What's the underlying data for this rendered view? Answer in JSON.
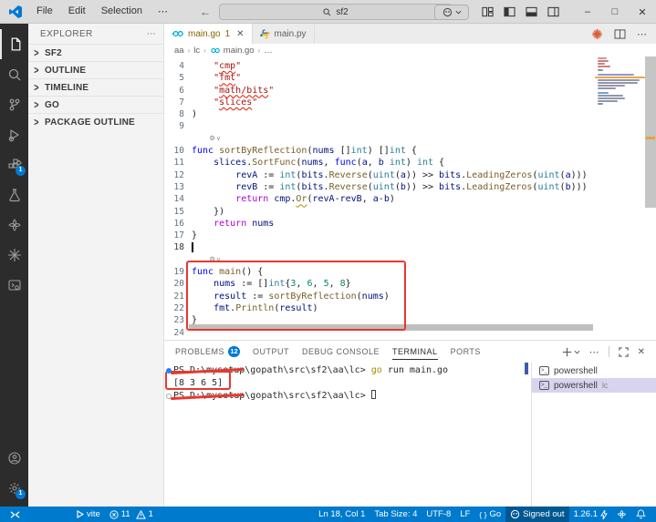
{
  "colors": {
    "accent": "#007acc",
    "badge": "#0078d4",
    "annotation": "#e8382c",
    "activity_bar_bg": "#2c2c2c",
    "warning_file": "#8a6400"
  },
  "titlebar": {
    "menus": [
      {
        "label": "File"
      },
      {
        "label": "Edit"
      },
      {
        "label": "Selection"
      }
    ],
    "search": {
      "value": "sf2"
    }
  },
  "activity_bar": {
    "items": [
      "explorer",
      "search",
      "source-control",
      "run-and-debug",
      "extensions",
      "testing",
      "pinwheel",
      "starburst",
      "remote-tools"
    ],
    "extensions_badge": "1",
    "settings_badge": "1"
  },
  "sidebar": {
    "header": "EXPLORER",
    "sections": [
      {
        "label": "SF2"
      },
      {
        "label": "OUTLINE"
      },
      {
        "label": "TIMELINE"
      },
      {
        "label": "GO"
      },
      {
        "label": "PACKAGE OUTLINE"
      }
    ]
  },
  "editor": {
    "tabs": [
      {
        "label": "main.go",
        "badge": "1",
        "active": true
      },
      {
        "label": "main.py",
        "active": false
      }
    ],
    "breadcrumb": [
      "aa",
      "lc",
      "main.go",
      "…"
    ],
    "code": {
      "lines": [
        {
          "num": "4",
          "tokens": [
            [
              "s",
              "    \""
            ],
            [
              "su",
              "cmp"
            ],
            [
              "s",
              "\""
            ]
          ]
        },
        {
          "num": "5",
          "tokens": [
            [
              "s",
              "    \""
            ],
            [
              "su",
              "fmt"
            ],
            [
              "s",
              "\""
            ]
          ]
        },
        {
          "num": "6",
          "tokens": [
            [
              "s",
              "    \""
            ],
            [
              "su",
              "math/bits"
            ],
            [
              "s",
              "\""
            ]
          ]
        },
        {
          "num": "7",
          "tokens": [
            [
              "s",
              "    \""
            ],
            [
              "su",
              "slices"
            ],
            [
              "s",
              "\""
            ]
          ]
        },
        {
          "num": "8",
          "tokens": [
            [
              "p",
              ")"
            ]
          ]
        },
        {
          "num": "9",
          "tokens": []
        },
        {
          "lens": true
        },
        {
          "num": "10",
          "tokens": [
            [
              "k",
              "func"
            ],
            [
              "p",
              " "
            ],
            [
              "f",
              "sortByReflection"
            ],
            [
              "p",
              "("
            ],
            [
              "v",
              "nums"
            ],
            [
              "p",
              " []"
            ],
            [
              "t",
              "int"
            ],
            [
              "p",
              ") []"
            ],
            [
              "t",
              "int"
            ],
            [
              "p",
              " {"
            ]
          ]
        },
        {
          "num": "11",
          "tokens": [
            [
              "p",
              "    "
            ],
            [
              "v",
              "slices"
            ],
            [
              "p",
              "."
            ],
            [
              "f",
              "SortFunc"
            ],
            [
              "p",
              "("
            ],
            [
              "v",
              "nums"
            ],
            [
              "p",
              ", "
            ],
            [
              "k",
              "func"
            ],
            [
              "p",
              "("
            ],
            [
              "v",
              "a"
            ],
            [
              "p",
              ", "
            ],
            [
              "v",
              "b"
            ],
            [
              "p",
              " "
            ],
            [
              "t",
              "int"
            ],
            [
              "p",
              ") "
            ],
            [
              "t",
              "int"
            ],
            [
              "p",
              " {"
            ]
          ]
        },
        {
          "num": "12",
          "tokens": [
            [
              "p",
              "        "
            ],
            [
              "v",
              "revA"
            ],
            [
              "p",
              " := "
            ],
            [
              "t",
              "int"
            ],
            [
              "p",
              "("
            ],
            [
              "v",
              "bits"
            ],
            [
              "p",
              "."
            ],
            [
              "f",
              "Reverse"
            ],
            [
              "p",
              "("
            ],
            [
              "t",
              "uint"
            ],
            [
              "p",
              "("
            ],
            [
              "v",
              "a"
            ],
            [
              "p",
              ")) >> "
            ],
            [
              "v",
              "bits"
            ],
            [
              "p",
              "."
            ],
            [
              "f",
              "LeadingZeros"
            ],
            [
              "p",
              "("
            ],
            [
              "t",
              "uint"
            ],
            [
              "p",
              "("
            ],
            [
              "v",
              "a"
            ],
            [
              "p",
              ")))"
            ]
          ]
        },
        {
          "num": "13",
          "tokens": [
            [
              "p",
              "        "
            ],
            [
              "v",
              "revB"
            ],
            [
              "p",
              " := "
            ],
            [
              "t",
              "int"
            ],
            [
              "p",
              "("
            ],
            [
              "v",
              "bits"
            ],
            [
              "p",
              "."
            ],
            [
              "f",
              "Reverse"
            ],
            [
              "p",
              "("
            ],
            [
              "t",
              "uint"
            ],
            [
              "p",
              "("
            ],
            [
              "v",
              "b"
            ],
            [
              "p",
              ")) >> "
            ],
            [
              "v",
              "bits"
            ],
            [
              "p",
              "."
            ],
            [
              "f",
              "LeadingZeros"
            ],
            [
              "p",
              "("
            ],
            [
              "t",
              "uint"
            ],
            [
              "p",
              "("
            ],
            [
              "v",
              "b"
            ],
            [
              "p",
              ")))"
            ]
          ]
        },
        {
          "num": "14",
          "tokens": [
            [
              "p",
              "        "
            ],
            [
              "c",
              "return"
            ],
            [
              "p",
              " "
            ],
            [
              "v",
              "cmp"
            ],
            [
              "p",
              "."
            ],
            [
              "fw",
              "Or"
            ],
            [
              "p",
              "("
            ],
            [
              "v",
              "revA"
            ],
            [
              "p",
              "-"
            ],
            [
              "v",
              "revB"
            ],
            [
              "p",
              ", "
            ],
            [
              "v",
              "a"
            ],
            [
              "p",
              "-"
            ],
            [
              "v",
              "b"
            ],
            [
              "p",
              ")"
            ]
          ]
        },
        {
          "num": "15",
          "tokens": [
            [
              "p",
              "    })"
            ]
          ]
        },
        {
          "num": "16",
          "tokens": [
            [
              "p",
              "    "
            ],
            [
              "c",
              "return"
            ],
            [
              "p",
              " "
            ],
            [
              "v",
              "nums"
            ]
          ]
        },
        {
          "num": "17",
          "tokens": [
            [
              "p",
              "}"
            ]
          ]
        },
        {
          "num": "18",
          "tokens": [],
          "cursor": true
        },
        {
          "lens": true
        },
        {
          "num": "19",
          "tokens": [
            [
              "k",
              "func"
            ],
            [
              "p",
              " "
            ],
            [
              "f",
              "main"
            ],
            [
              "p",
              "() {"
            ]
          ]
        },
        {
          "num": "20",
          "tokens": [
            [
              "p",
              "    "
            ],
            [
              "v",
              "nums"
            ],
            [
              "p",
              " := []"
            ],
            [
              "t",
              "int"
            ],
            [
              "p",
              "{"
            ],
            [
              "n",
              "3"
            ],
            [
              "p",
              ", "
            ],
            [
              "n",
              "6"
            ],
            [
              "p",
              ", "
            ],
            [
              "n",
              "5"
            ],
            [
              "p",
              ", "
            ],
            [
              "n",
              "8"
            ],
            [
              "p",
              "}"
            ]
          ]
        },
        {
          "num": "21",
          "tokens": [
            [
              "p",
              "    "
            ],
            [
              "v",
              "result"
            ],
            [
              "p",
              " := "
            ],
            [
              "f",
              "sortByReflection"
            ],
            [
              "p",
              "("
            ],
            [
              "v",
              "nums"
            ],
            [
              "p",
              ")"
            ]
          ]
        },
        {
          "num": "22",
          "tokens": [
            [
              "p",
              "    "
            ],
            [
              "v",
              "fmt"
            ],
            [
              "p",
              "."
            ],
            [
              "f",
              "Println"
            ],
            [
              "p",
              "("
            ],
            [
              "v",
              "result"
            ],
            [
              "p",
              ")"
            ]
          ]
        },
        {
          "num": "23",
          "tokens": [
            [
              "p",
              "}"
            ]
          ]
        },
        {
          "num": "24",
          "tokens": []
        }
      ]
    }
  },
  "panel": {
    "tabs": [
      {
        "label": "PROBLEMS",
        "badge": "12",
        "active": false
      },
      {
        "label": "OUTPUT",
        "active": false
      },
      {
        "label": "DEBUG CONSOLE",
        "active": false
      },
      {
        "label": "TERMINAL",
        "active": true
      },
      {
        "label": "PORTS",
        "active": false
      }
    ],
    "terminal": {
      "lines": [
        {
          "deco": "filled",
          "tokens": [
            [
              "pr",
              "PS D:\\mysetup\\gopath\\src\\sf2\\aa\\lc> "
            ],
            [
              "cmd",
              "go"
            ],
            [
              "pr",
              " run main.go"
            ]
          ]
        },
        {
          "tokens": [
            [
              "pr",
              "[8 3 6 5]"
            ]
          ]
        },
        {
          "deco": "empty",
          "tokens": [
            [
              "pr",
              "PS D:\\mysetup\\gopath\\src\\sf2\\aa\\lc> "
            ]
          ],
          "cursor": true
        }
      ],
      "list": [
        {
          "label": "powershell",
          "desc": "",
          "selected": false
        },
        {
          "label": "powershell",
          "desc": "lc",
          "selected": true
        }
      ]
    }
  },
  "status_bar": {
    "left": [
      {
        "name": "vite-task",
        "label": "vite"
      },
      {
        "name": "problems-summary",
        "errors": "11",
        "warnings": "1"
      }
    ],
    "right": {
      "cursor_position": "Ln 18, Col 1",
      "tab_size": "Tab Size: 4",
      "encoding": "UTF-8",
      "eol": "LF",
      "language": "Go",
      "copilot": "Signed out",
      "go_version": "1.26.1"
    }
  }
}
